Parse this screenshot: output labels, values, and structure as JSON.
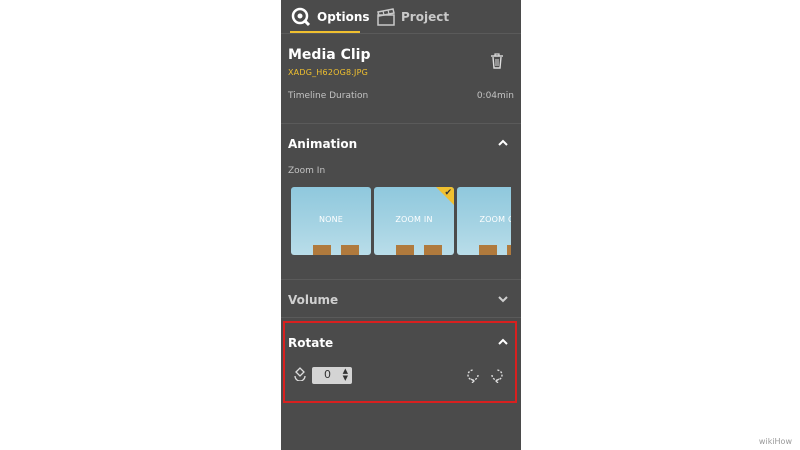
{
  "tabs": [
    {
      "label": "Options",
      "icon": "options-icon",
      "active": true
    },
    {
      "label": "Project",
      "icon": "clapperboard-icon",
      "active": false
    }
  ],
  "clip": {
    "title": "Media Clip",
    "filename": "XADG_H62OG8.JPG",
    "duration_label": "Timeline Duration",
    "duration_value": "0:04min"
  },
  "animation": {
    "title": "Animation",
    "selected_label": "Zoom In",
    "options": [
      {
        "label": "NONE",
        "selected": false
      },
      {
        "label": "ZOOM IN",
        "selected": true
      },
      {
        "label": "ZOOM O",
        "selected": false
      }
    ]
  },
  "volume": {
    "title": "Volume"
  },
  "rotate": {
    "title": "Rotate",
    "value": "0"
  },
  "watermark": "wikiHow",
  "colors": {
    "panel": "#4b4b4b",
    "accent": "#f0c02f",
    "highlight_border": "#d8201f"
  }
}
